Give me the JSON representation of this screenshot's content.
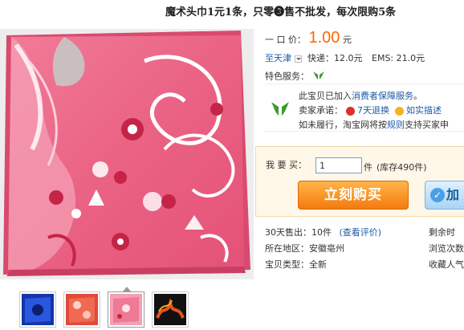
{
  "title": "魔术头巾1元1条，只零❸售不批发，每次限购5条",
  "price": {
    "label": "一 口 价：",
    "value": "1.00",
    "unit": "元"
  },
  "shipping": {
    "to": "至天津",
    "express": "快递：12.0元",
    "ems": "EMS: 21.0元"
  },
  "service": {
    "label": "特色服务："
  },
  "consumer": {
    "line1_prefix": "此宝贝已加入",
    "line1_link": "消费者保障服务",
    "line1_suffix": "。",
    "promise_label": "卖家承诺：",
    "promise_return": "7天退换",
    "promise_desc": "如实描述",
    "line3_prefix": "如未履行，淘宝网将按",
    "line3_link": "规则",
    "line3_suffix": "支持买家申"
  },
  "purchase": {
    "label": "我 要 买：",
    "quantity": "1",
    "unit": "件",
    "stock": "(库存490件)",
    "buy_button": "立刻购买",
    "cart_button": "加"
  },
  "stats": {
    "sold_label": "30天售出：",
    "sold_value": "10件",
    "review_link": "(查看评价)",
    "remaining": "剩余时",
    "location_label": "所在地区：",
    "location_value": "安徽亳州",
    "views": "浏览次数",
    "type_label": "宝贝类型：",
    "type_value": "全新",
    "collect": "收藏人气"
  },
  "colors": {
    "price": "#ff6600",
    "link": "#1c5aa6",
    "buy_button": "#f57a0e",
    "product": "#e9607f"
  }
}
